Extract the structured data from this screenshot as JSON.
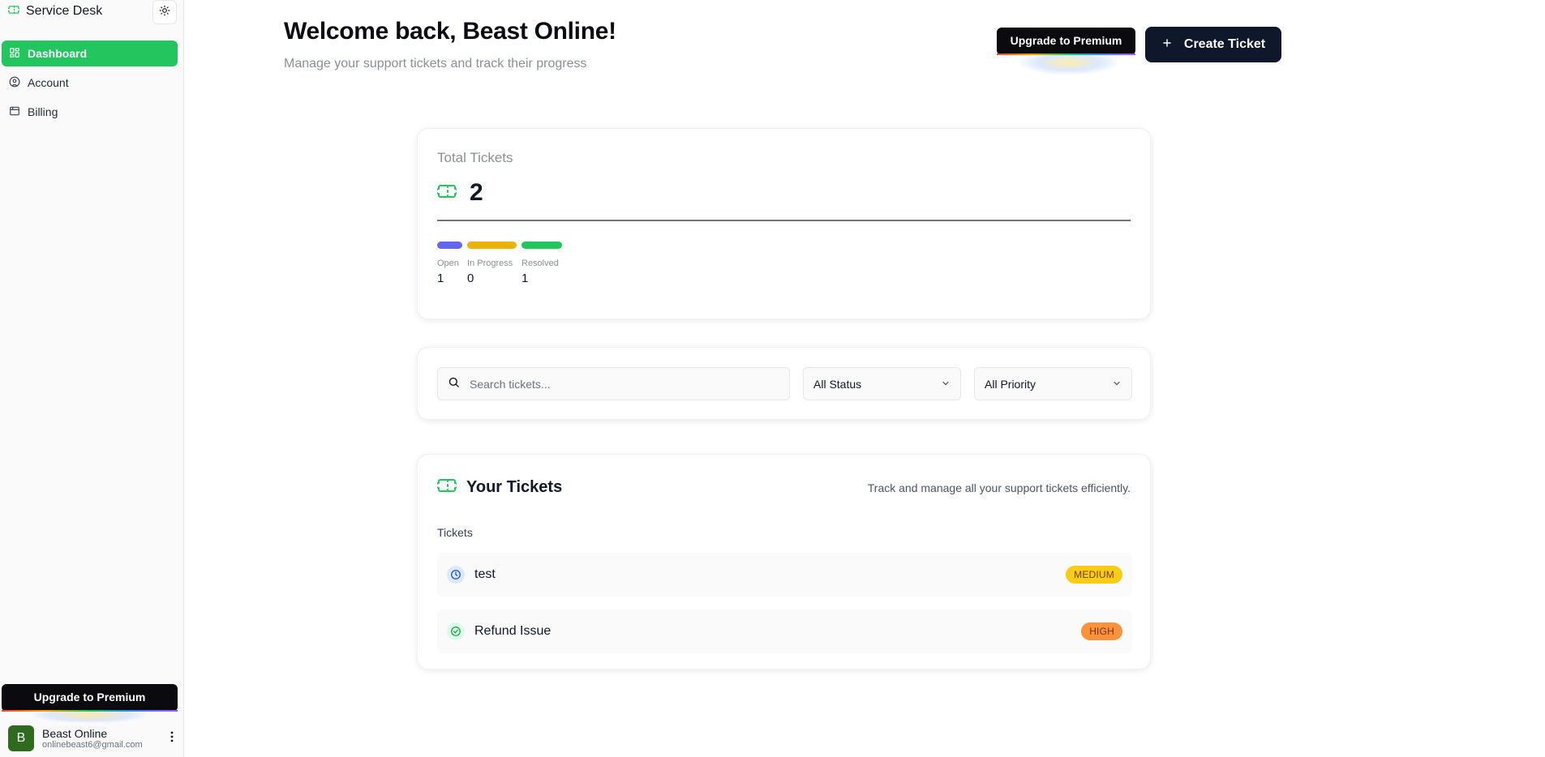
{
  "sidebar": {
    "app_title": "Service Desk",
    "nav": [
      {
        "label": "Dashboard",
        "icon": "dashboard-grid-icon",
        "active": true
      },
      {
        "label": "Account",
        "icon": "user-circle-icon",
        "active": false
      },
      {
        "label": "Billing",
        "icon": "billing-icon",
        "active": false
      }
    ],
    "upgrade_label": "Upgrade to Premium",
    "user": {
      "initial": "B",
      "name": "Beast Online",
      "email": "onlinebeast6@gmail.com"
    }
  },
  "header": {
    "welcome": "Welcome back, Beast Online!",
    "subtitle": "Manage your support tickets and track their progress",
    "upgrade_label": "Upgrade to Premium",
    "create_label": "Create Ticket"
  },
  "stats": {
    "label": "Total Tickets",
    "total": "2",
    "breakdown": [
      {
        "label": "Open",
        "value": "1",
        "color": "#6366f1"
      },
      {
        "label": "In Progress",
        "value": "0",
        "color": "#eab308"
      },
      {
        "label": "Resolved",
        "value": "1",
        "color": "#22c55e"
      }
    ]
  },
  "filters": {
    "search_placeholder": "Search tickets...",
    "status_selected": "All Status",
    "priority_selected": "All Priority"
  },
  "tickets": {
    "title": "Your Tickets",
    "description": "Track and manage all your support tickets efficiently.",
    "section_label": "Tickets",
    "items": [
      {
        "name": "test",
        "status_icon": "clock-icon",
        "priority": "MEDIUM",
        "priority_bg": "#facc15",
        "priority_fg": "#713f12"
      },
      {
        "name": "Refund Issue",
        "status_icon": "check-circle-icon",
        "priority": "HIGH",
        "priority_bg": "#fb923c",
        "priority_fg": "#7c2d12"
      }
    ]
  },
  "colors": {
    "accent": "#22c55e",
    "dark": "#0f172a"
  }
}
